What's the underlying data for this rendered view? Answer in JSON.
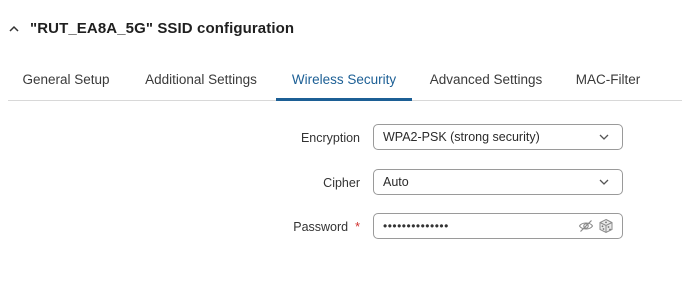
{
  "section": {
    "title": "\"RUT_EA8A_5G\" SSID configuration",
    "collapse_icon": "chevron-up-icon"
  },
  "tabs": [
    {
      "label": "General Setup",
      "active": false
    },
    {
      "label": "Additional Settings",
      "active": false
    },
    {
      "label": "Wireless Security",
      "active": true
    },
    {
      "label": "Advanced Settings",
      "active": false
    },
    {
      "label": "MAC-Filter",
      "active": false
    }
  ],
  "form": {
    "encryption": {
      "label": "Encryption",
      "value": "WPA2-PSK (strong security)",
      "icon": "chevron-down-icon"
    },
    "cipher": {
      "label": "Cipher",
      "value": "Auto",
      "icon": "chevron-down-icon"
    },
    "password": {
      "label": "Password",
      "required_marker": "*",
      "masked_value": "••••••••••••••",
      "toggle_icon": "eye-slash-icon",
      "generate_icon": "dice-icon"
    }
  },
  "colors": {
    "accent": "#1c5f95",
    "required": "#d0302d",
    "border": "#9a9a9a"
  }
}
